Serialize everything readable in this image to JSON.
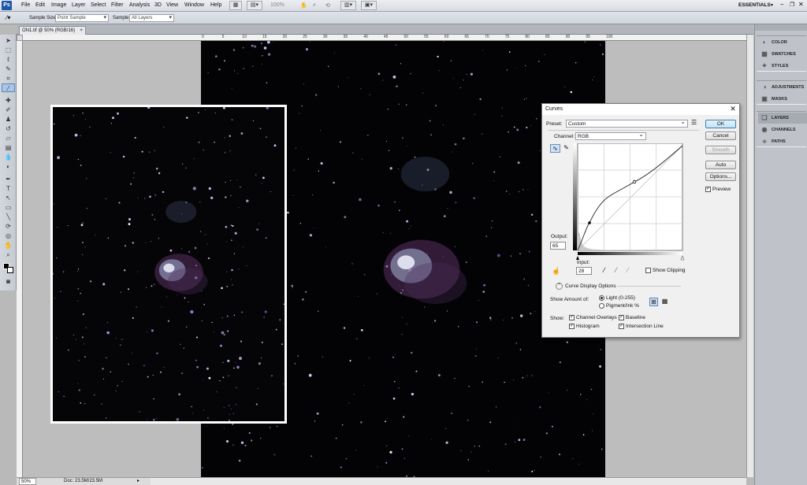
{
  "app": {
    "logo": "Ps",
    "workspace": "ESSENTIALS"
  },
  "menu": [
    "File",
    "Edit",
    "Image",
    "Layer",
    "Select",
    "Filter",
    "Analysis",
    "3D",
    "View",
    "Window",
    "Help"
  ],
  "menubar": {
    "zoom": "100%"
  },
  "options": {
    "sample_size_label": "Sample Size:",
    "sample_size_value": "Point Sample",
    "sample_label": "Sample:",
    "sample_value": "All Layers"
  },
  "document": {
    "tab_title": "ON1.tif @ 50% (RGB/16)",
    "zoom": "50%",
    "doc_info": "Doc: 23.5M/23.5M"
  },
  "ruler_labels": [
    "0",
    "5",
    "10",
    "15",
    "20",
    "25",
    "30",
    "35",
    "40",
    "45",
    "50",
    "55",
    "60",
    "65",
    "70",
    "75",
    "80",
    "85",
    "90",
    "95",
    "100"
  ],
  "panels": {
    "group1": [
      "COLOR",
      "SWATCHES",
      "STYLES"
    ],
    "group2": [
      "ADJUSTMENTS",
      "MASKS"
    ],
    "group3": [
      "LAYERS",
      "CHANNELS",
      "PATHS"
    ]
  },
  "curves": {
    "title": "Curves",
    "preset_label": "Preset:",
    "preset_value": "Custom",
    "channel_label": "Channel:",
    "channel_value": "RGB",
    "ok": "OK",
    "cancel": "Cancel",
    "smooth": "Smooth",
    "auto": "Auto",
    "options": "Options...",
    "preview": "Preview",
    "output_label": "Output:",
    "output_value": "65",
    "input_label": "Input:",
    "input_value": "28",
    "show_clipping": "Show Clipping",
    "display_options": "Curve Display Options",
    "show_amount_label": "Show Amount of:",
    "light": "Light  (0-255)",
    "pigment": "Pigment/Ink %",
    "show_label": "Show:",
    "channel_overlays": "Channel Overlays",
    "baseline": "Baseline",
    "histogram": "Histogram",
    "intersection_line": "Intersection Line"
  }
}
